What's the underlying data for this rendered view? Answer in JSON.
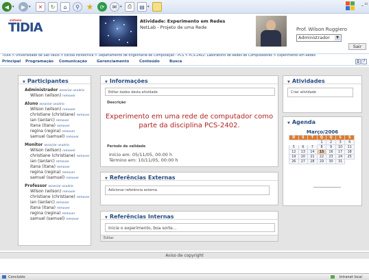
{
  "header": {
    "logo_super": "sistema",
    "logo": "TIDIA",
    "activity_title": "Atividade: Experimento em Redes",
    "activity_subtitle": "NetLab - Projeto de uma Rede",
    "user_name": "Prof. Wilson Ruggiero",
    "role_selected": "Administrador",
    "exit_label": "Sair"
  },
  "breadcrumb": "TIDIA > Universidade de São Paulo > Escola Politécnica > Departamento de Engenharia de Computação - PCS > PCS-2402: Laboratório de Redes de Computadores > Experimento em Redes",
  "nav": {
    "items": [
      "Principal",
      "Programação",
      "Comunicação",
      "Gerenciamento",
      "Conteúdo",
      "Busca"
    ]
  },
  "participants": {
    "title": "Participantes",
    "admin_title": "Administrador",
    "admin_link": "associar usuário",
    "admin_members": [
      "Wilson (wilson)"
    ],
    "aluno_title": "Aluno",
    "aluno_link": "associar usuário",
    "aluno_members": [
      "Wilson (wilson)",
      "christiane (christiane)",
      "ian (ianlarc)",
      "itana (itana)",
      "regina (regina)",
      "samuel (samuel)"
    ],
    "monitor_title": "Monitor",
    "monitor_link": "associar usuário",
    "monitor_members": [
      "Wilson (wilson)",
      "christiane (christiane)",
      "ian (ianlarc)",
      "itana (itana)",
      "regina (regina)",
      "samuel (samuel)"
    ],
    "professor_title": "Professor",
    "professor_link": "associar usuário",
    "professor_members": [
      "Wilson (wilson)",
      "christiane (christiane)",
      "ian (ianlarc)",
      "itana (itana)",
      "regina (regina)",
      "samuel (samuel)"
    ],
    "remove_label": "remover"
  },
  "info": {
    "title": "Informações",
    "edit_label": "Editar dados desta atividade",
    "desc_label": "Descrição",
    "desc_text": "Experimento em uma rede de computador como parte da disciplina PCS-2402.",
    "validity_label": "Período de validade",
    "start": "Início em: 05/11/05, 00:00 h",
    "end": "Término em: 10/11/05, 00:00 h"
  },
  "ref_ext": {
    "title": "Referências Externas",
    "add_label": "Adicionar referência externa"
  },
  "ref_int": {
    "title": "Referências Internas",
    "text": "Inicie o experimento, boa sorte...",
    "edit_label": "Editar"
  },
  "activities": {
    "title": "Atividades",
    "create_label": "Criar atividade"
  },
  "agenda": {
    "title": "Agenda",
    "month": "Março/2006",
    "weekdays": [
      "D",
      "S",
      "T",
      "Q",
      "Q",
      "S",
      "S"
    ],
    "weeks": [
      [
        "",
        "",
        "",
        "1",
        "2",
        "3",
        "4"
      ],
      [
        "5",
        "6",
        "7",
        "8",
        "9",
        "10",
        "11"
      ],
      [
        "12",
        "13",
        "14",
        "15",
        "16",
        "17",
        "18"
      ],
      [
        "19",
        "20",
        "21",
        "22",
        "23",
        "24",
        "25"
      ],
      [
        "26",
        "27",
        "28",
        "29",
        "30",
        "31",
        ""
      ]
    ],
    "today": "15"
  },
  "footer": {
    "copyright": "Aviso de copyright"
  },
  "statusbar": {
    "left": "Concluído",
    "right": "Intranet local"
  },
  "colors": {
    "accent": "#234a80",
    "highlight_text": "#b02020",
    "calendar_header": "#e07a2a"
  }
}
